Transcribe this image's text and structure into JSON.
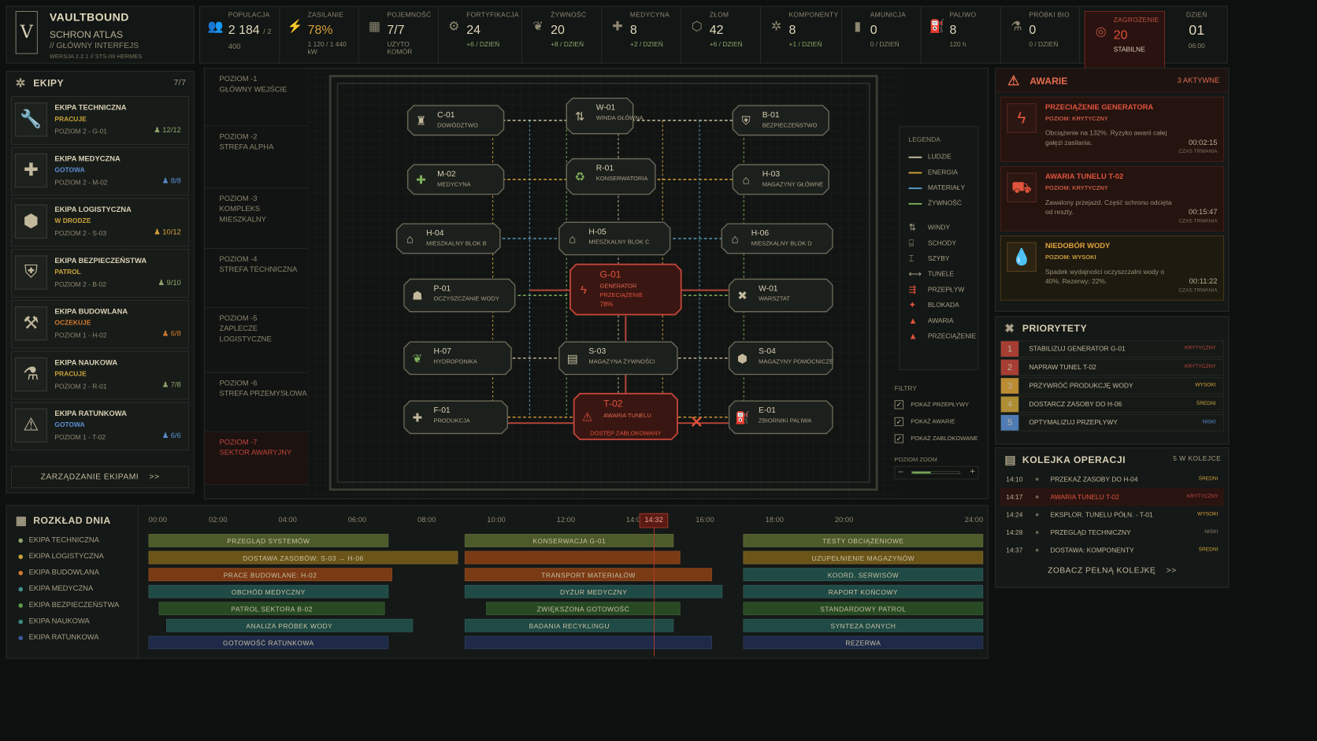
{
  "app": {
    "logo_letter": "V",
    "title": "VAULTBOUND",
    "subtitle": "SCHRON ATLAS",
    "tagline": "// GŁÓWNY INTERFEJS",
    "version": "WERSJA 2.2.1 // STS-09 HERMES"
  },
  "stats": [
    {
      "icon": "people-icon",
      "glyph": "👥",
      "label": "POPULACJA",
      "value": "2 184",
      "value_small": "/ 2 400",
      "sub": ""
    },
    {
      "icon": "power-icon",
      "glyph": "⚡",
      "label": "ZASILANIE",
      "value": "78%",
      "value_small": "",
      "sub": "1 120 / 1 440 kW",
      "accent": "#d9a13a"
    },
    {
      "icon": "capacity-icon",
      "glyph": "▦",
      "label": "POJEMNOŚĆ",
      "value": "7/7",
      "value_small": "",
      "sub": "UŻYTO KOMÓR"
    },
    {
      "icon": "fortification-icon",
      "glyph": "⚙",
      "label": "FORTYFIKACJA",
      "value": "24",
      "value_small": "",
      "sub": "+6 / DZIEŃ",
      "subgreen": true
    },
    {
      "icon": "food-icon",
      "glyph": "❦",
      "label": "ŻYWNOŚĆ",
      "value": "20",
      "value_small": "",
      "sub": "+8 / DZIEŃ",
      "subgreen": true
    },
    {
      "icon": "medical-icon",
      "glyph": "✚",
      "label": "MEDYCYNA",
      "value": "8",
      "value_small": "",
      "sub": "+2 / DZIEŃ",
      "subgreen": true
    },
    {
      "icon": "scrap-icon",
      "glyph": "⬡",
      "label": "ZŁOM",
      "value": "42",
      "value_small": "",
      "sub": "+6 / DZIEŃ",
      "subgreen": true
    },
    {
      "icon": "components-icon",
      "glyph": "✲",
      "label": "KOMPONENTY",
      "value": "8",
      "value_small": "",
      "sub": "+1 / DZIEŃ",
      "subgreen": true
    },
    {
      "icon": "ammo-icon",
      "glyph": "▮",
      "label": "AMUNICJA",
      "value": "0",
      "value_small": "",
      "sub": "0 / DZIEŃ"
    },
    {
      "icon": "fuel-icon",
      "glyph": "⛽",
      "label": "PALIWO",
      "value": "8",
      "value_small": "",
      "sub": "120 h"
    },
    {
      "icon": "biosample-icon",
      "glyph": "⚗",
      "label": "PRÓBKI BIO",
      "value": "0",
      "value_small": "",
      "sub": "0 / DZIEŃ"
    }
  ],
  "threat": {
    "icon": "threat-icon",
    "label": "ZAGROŻENIE",
    "value": "20",
    "sub": "STABILNE"
  },
  "day": {
    "label": "DZIEŃ",
    "value": "01",
    "time": "06:00"
  },
  "teams": {
    "title": "EKIPY",
    "count": "7/7",
    "manage_label": "ZARZĄDZANIE EKIPAMI",
    "manage_arrow": ">>",
    "items": [
      {
        "icon": "wrench-icon",
        "glyph": "🔧",
        "name": "EKIPA TECHNICZNA",
        "status": "PRACUJE",
        "status_color": "#c9a23a",
        "location": "POZIOM 2 - G-01",
        "count": "12/12",
        "count_color": "#8fa56c"
      },
      {
        "icon": "medical-cross-icon",
        "glyph": "✚",
        "name": "EKIPA MEDYCZNA",
        "status": "GOTOWA",
        "status_color": "#5b8ed1",
        "location": "POZIOM 2 - M-02",
        "count": "8/8",
        "count_color": "#5b8ed1"
      },
      {
        "icon": "crate-icon",
        "glyph": "⬢",
        "name": "EKIPA LOGISTYCZNA",
        "status": "W DRODZE",
        "status_color": "#c9a23a",
        "location": "POZIOM 2 - S-03",
        "count": "10/12",
        "count_color": "#d9a13a"
      },
      {
        "icon": "shield-icon",
        "glyph": "⛨",
        "name": "EKIPA BEZPIECZEŃSTWA",
        "status": "PATROL",
        "status_color": "#c9a23a",
        "location": "POZIOM 2 - B-02",
        "count": "9/10",
        "count_color": "#8fa56c"
      },
      {
        "icon": "hammer-icon",
        "glyph": "⚒",
        "name": "EKIPA BUDOWLANA",
        "status": "OCZEKUJE",
        "status_color": "#d17a2f",
        "location": "POZIOM 1 - H-02",
        "count": "6/8",
        "count_color": "#d17a2f"
      },
      {
        "icon": "flask-icon",
        "glyph": "⚗",
        "name": "EKIPA NAUKOWA",
        "status": "PRACUJE",
        "status_color": "#c9a23a",
        "location": "POZIOM 2 - R-01",
        "count": "7/8",
        "count_color": "#8fa56c"
      },
      {
        "icon": "rescue-icon",
        "glyph": "⚠",
        "name": "EKIPA RATUNKOWA",
        "status": "GOTOWA",
        "status_color": "#5b8ed1",
        "location": "POZIOM 1 - T-02",
        "count": "6/6",
        "count_color": "#5b8ed1"
      }
    ]
  },
  "levels": [
    {
      "name": "POZIOM -1",
      "desc": "GŁÓWNY WEJŚCIE"
    },
    {
      "name": "POZIOM -2",
      "desc": "STREFA ALPHA"
    },
    {
      "name": "POZIOM -3",
      "desc": "KOMPLEKS MIESZKALNY"
    },
    {
      "name": "POZIOM -4",
      "desc": "STREFA TECHNICZNA"
    },
    {
      "name": "POZIOM -5",
      "desc": "ZAPLECZE LOGISTYCZNE"
    },
    {
      "name": "POZIOM -6",
      "desc": "STREFA PRZEMYSŁOWA"
    },
    {
      "name": "POZIOM -7",
      "desc": "SEKTOR AWARYJNY",
      "red": true
    }
  ],
  "nodes": [
    {
      "id": "C-01",
      "name": "DOWÓDZTWO",
      "icon": "command-icon",
      "glyph": "♜"
    },
    {
      "id": "W-01",
      "name": "WINDA GŁÓWNA",
      "icon": "elevator-icon",
      "glyph": "⇅"
    },
    {
      "id": "B-01",
      "name": "BEZPIECZEŃSTWO",
      "icon": "security-icon",
      "glyph": "⛨"
    },
    {
      "id": "M-02",
      "name": "MEDYCYNA",
      "icon": "medical-icon",
      "glyph": "✚"
    },
    {
      "id": "R-01",
      "name": "KONSERWATORIA",
      "icon": "recycle-icon",
      "glyph": "♻"
    },
    {
      "id": "H-03",
      "name": "MAGAZYNY GŁÓWNE",
      "icon": "storage-icon",
      "glyph": "⌂"
    },
    {
      "id": "H-04",
      "name": "MIESZKALNY BLOK B",
      "icon": "house-icon",
      "glyph": "⌂"
    },
    {
      "id": "H-05",
      "name": "MIESZKALNY BLOK C",
      "icon": "house-icon",
      "glyph": "⌂"
    },
    {
      "id": "H-06",
      "name": "MIESZKALNY BLOK D",
      "icon": "house-icon",
      "glyph": "⌂"
    },
    {
      "id": "P-01",
      "name": "OCZYSZCZANIE WODY",
      "icon": "water-icon",
      "glyph": "☗"
    },
    {
      "id": "G-01",
      "name": "GENERATOR",
      "status": "PRZECIĄŻENIE",
      "percent": "78%",
      "icon": "lightning-icon",
      "glyph": "ϟ"
    },
    {
      "id": "W-01",
      "name": "WARSZTAT",
      "icon": "tools-icon",
      "glyph": "✖"
    },
    {
      "id": "H-07",
      "name": "HYDROPONIKA",
      "icon": "plant-icon",
      "glyph": "❦"
    },
    {
      "id": "S-03",
      "name": "MAGAZYNA ŻYWNOŚCI",
      "icon": "food-storage-icon",
      "glyph": "▤"
    },
    {
      "id": "S-04",
      "name": "MAGAZYNY POMOCNICZE",
      "icon": "crate-icon",
      "glyph": "⬢"
    },
    {
      "id": "F-01",
      "name": "PRODUKCJA",
      "icon": "production-icon",
      "glyph": "✚"
    },
    {
      "id": "T-02",
      "name": "AWARIA TUNELU",
      "status": "DOSTĘP ZABLOKOWANY",
      "icon": "tunnel-alarm-icon",
      "glyph": "⚠"
    },
    {
      "id": "E-01",
      "name": "ZBIORNIKI PALIWA",
      "icon": "fuel-tank-icon",
      "glyph": "⛽"
    }
  ],
  "legend": {
    "title": "LEGENDA",
    "lines": [
      {
        "label": "LUDZIE",
        "color": "#c9c0a4"
      },
      {
        "label": "ENERGIA",
        "color": "#d9a13a"
      },
      {
        "label": "MATERIAŁY",
        "color": "#5aa0c8"
      },
      {
        "label": "ŻYWNOŚĆ",
        "color": "#7fb05a"
      }
    ],
    "icons": [
      {
        "label": "WINDY",
        "icon": "elevator-icon",
        "glyph": "⇅"
      },
      {
        "label": "SCHODY",
        "icon": "stairs-icon",
        "glyph": "⌸"
      },
      {
        "label": "SZYBY",
        "icon": "shaft-icon",
        "glyph": "⌶"
      },
      {
        "label": "TUNELE",
        "icon": "tunnel-icon",
        "glyph": "⟷"
      },
      {
        "label": "PRZEPŁYW",
        "icon": "flow-icon",
        "glyph": "⇶"
      },
      {
        "label": "BLOKADA",
        "icon": "block-icon",
        "glyph": "✦"
      },
      {
        "label": "AWARIA",
        "icon": "failure-icon",
        "glyph": "▲"
      },
      {
        "label": "PRZECIĄŻENIE",
        "icon": "overload-icon",
        "glyph": "▲"
      }
    ]
  },
  "filters": {
    "title": "FILTRY",
    "items": [
      "POKAŻ PRZEPŁYWY",
      "POKAŻ AWARIE",
      "POKAŻ ZABLOKOWANE"
    ],
    "check": "✓",
    "zoom_label": "POZIOM ZOOM",
    "zoom_minus": "–",
    "zoom_plus": "+",
    "zoom_level": 0.4
  },
  "alerts": {
    "title": "AWARIE",
    "active": "3 AKTYWNE",
    "items": [
      {
        "icon": "lightning-icon",
        "glyph": "ϟ",
        "title": "PRZECIĄŻENIE GENERATORA",
        "level": "POZIOM: KRYTYCZNY",
        "desc": "Obciążenie na 132%. Ryzyko awarii całej gałęzi zasilania.",
        "time": "00:02:15",
        "time_label": "CZAS TRWANIA",
        "type": "red"
      },
      {
        "icon": "vehicle-icon",
        "glyph": "⛟",
        "title": "AWARIA TUNELU T-02",
        "level": "POZIOM: KRYTYCZNY",
        "desc": "Zawalony przejazd. Część schronu odcięta od reszty.",
        "time": "00:15:47",
        "time_label": "CZAS TRWANIA",
        "type": "red"
      },
      {
        "icon": "water-drop-icon",
        "glyph": "💧",
        "title": "NIEDOBÓR WODY",
        "level": "POZIOM: WYSOKI",
        "desc": "Spadek wydajności oczyszczalni wody o 40%. Rezerwy: 22%.",
        "time": "00:11:22",
        "time_label": "CZAS TRWANIA",
        "type": "amber"
      }
    ]
  },
  "priorities": {
    "title": "PRIORYTETY",
    "items": [
      {
        "n": "1",
        "task": "STABILIZUJ GENERATOR G-01",
        "level": "KRYTYCZNY",
        "color": "#c0453a"
      },
      {
        "n": "2",
        "task": "NAPRAW TUNEL T-02",
        "level": "KRYTYCZNY",
        "color": "#c0453a"
      },
      {
        "n": "3",
        "task": "PRZYWRÓĆ PRODUKCJĘ WODY",
        "level": "WYSOKI",
        "color": "#d9a13a"
      },
      {
        "n": "4",
        "task": "DOSTARCZ ZASOBY DO H-06",
        "level": "ŚREDNI",
        "color": "#c9a23a"
      },
      {
        "n": "5",
        "task": "OPTYMALIZUJ PRZEPŁYWY",
        "level": "NISKI",
        "color": "#5b8ed1"
      }
    ]
  },
  "queue": {
    "title": "KOLEJKA OPERACJI",
    "count": "5 W KOLEJCE",
    "more": "ZOBACZ PEŁNĄ KOLEJKĘ",
    "more_arrow": ">>",
    "items": [
      {
        "time": "14:10",
        "task": "PRZEKAŻ ZASOBY DO H-04",
        "level": "ŚREDNI",
        "color": "#c9a23a"
      },
      {
        "time": "14:17",
        "task": "AWARIA TUNELU T-02",
        "level": "KRYTYCZNY",
        "color": "#c0453a",
        "highlight": true
      },
      {
        "time": "14:24",
        "task": "EKSPLOR. TUNELU PÓŁN. - T-01",
        "level": "WYSOKI",
        "color": "#d9a13a"
      },
      {
        "time": "14:28",
        "task": "PRZEGLĄD TECHNICZNY",
        "level": "NISKI",
        "color": "#8e8670"
      },
      {
        "time": "14:37",
        "task": "DOSTAWA: KOMPONENTY",
        "level": "ŚREDNI",
        "color": "#c9a23a"
      }
    ]
  },
  "schedule": {
    "title": "ROZKŁAD DNIA",
    "ticks": [
      "00:00",
      "02:00",
      "04:00",
      "06:00",
      "08:00",
      "10:00",
      "12:00",
      "14:00",
      "16:00",
      "18:00",
      "20:00",
      "24:00"
    ],
    "tick_hours": [
      0,
      2,
      4,
      6,
      8,
      10,
      12,
      14,
      16,
      18,
      20,
      24
    ],
    "now": "14:32",
    "now_hours": 14.53,
    "teams": [
      {
        "name": "EKIPA TECHNICZNA",
        "color": "#8fa56c"
      },
      {
        "name": "EKIPA LOGISTYCZNA",
        "color": "#c9a23a"
      },
      {
        "name": "EKIPA BUDOWLANA",
        "color": "#d17a2f"
      },
      {
        "name": "EKIPA MEDYCZNA",
        "color": "#3f8f88"
      },
      {
        "name": "EKIPA BEZPIECZEŃSTWA",
        "color": "#5f9a4a"
      },
      {
        "name": "EKIPA NAUKOWA",
        "color": "#3a8a7f"
      },
      {
        "name": "EKIPA RATUNKOWA",
        "color": "#3b5a9a"
      }
    ],
    "rows": [
      {
        "color": "#4d5a2a",
        "bars": [
          {
            "s": 0,
            "e": 6.9,
            "label": "PRZEGLĄD SYSTEMÓW"
          },
          {
            "s": 9.1,
            "e": 15.1,
            "label": "KONSERWACJA G-01"
          },
          {
            "s": 17.1,
            "e": 24,
            "label": "TESTY OBCIĄŻENIOWE"
          }
        ]
      },
      {
        "color": "#6a5418",
        "bars": [
          {
            "s": 0,
            "e": 8.9,
            "label": "DOSTAWA ZASOBÓW: S-03 → H-06"
          },
          {
            "s": 9.1,
            "e": 15.3,
            "label": "",
            "col": "#7a3a14"
          },
          {
            "s": 17.1,
            "e": 24,
            "label": "UZUPEŁNIENIE MAGAZYNÓW"
          }
        ]
      },
      {
        "color": "#7a3a14",
        "bars": [
          {
            "s": 0,
            "e": 7.0,
            "label": "PRACE BUDOWLANE: H-02"
          },
          {
            "s": 9.1,
            "e": 16.2,
            "label": "TRANSPORT MATERIAŁÓW"
          },
          {
            "s": 17.1,
            "e": 24,
            "label": "KOORD. SERWISÓW",
            "col": "#1f4a45"
          }
        ]
      },
      {
        "color": "#1f4a45",
        "bars": [
          {
            "s": 0,
            "e": 6.9,
            "label": "OBCHÓD MEDYCZNY"
          },
          {
            "s": 9.1,
            "e": 16.5,
            "label": "DYŻUR MEDYCZNY"
          },
          {
            "s": 17.1,
            "e": 24,
            "label": "RAPORT KOŃCOWY"
          }
        ]
      },
      {
        "color": "#274a22",
        "bars": [
          {
            "s": 0.3,
            "e": 6.8,
            "label": "PATROL SEKTORA B-02"
          },
          {
            "s": 9.7,
            "e": 15.3,
            "label": "ZWIĘKSZONA GOTOWOŚĆ"
          },
          {
            "s": 17.1,
            "e": 24,
            "label": "STANDARDOWY PATROL"
          }
        ]
      },
      {
        "color": "#1f4a45",
        "bars": [
          {
            "s": 0.5,
            "e": 7.6,
            "label": "ANALIZA PRÓBEK WODY"
          },
          {
            "s": 9.1,
            "e": 15.1,
            "label": "BADANIA RECYKLINGU"
          },
          {
            "s": 17.1,
            "e": 24,
            "label": "SYNTEZA DANYCH"
          }
        ]
      },
      {
        "color": "#1e2a48",
        "bars": [
          {
            "s": 0,
            "e": 6.9,
            "label": "GOTOWOŚĆ RATUNKOWA"
          },
          {
            "s": 9.1,
            "e": 16.2,
            "label": ""
          },
          {
            "s": 17.1,
            "e": 24,
            "label": "REZERWA"
          }
        ]
      }
    ]
  }
}
